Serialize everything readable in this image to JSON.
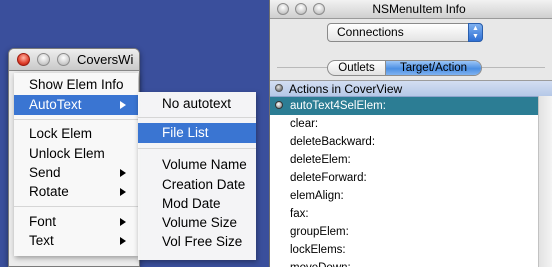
{
  "covers_window": {
    "title": "CoversWi"
  },
  "context_menu": {
    "items": [
      {
        "label": "Show Elem Info"
      },
      {
        "label": "AutoText"
      },
      {
        "label": "Lock Elem"
      },
      {
        "label": "Unlock Elem"
      },
      {
        "label": "Send"
      },
      {
        "label": "Rotate"
      },
      {
        "label": "Font"
      },
      {
        "label": "Text"
      }
    ]
  },
  "autotext_submenu": {
    "items": [
      {
        "label": "No autotext"
      },
      {
        "label": "File List"
      },
      {
        "label": "Volume Name"
      },
      {
        "label": "Creation Date"
      },
      {
        "label": "Mod Date"
      },
      {
        "label": "Volume Size"
      },
      {
        "label": "Vol Free Size"
      }
    ]
  },
  "info_window": {
    "title": "NSMenuItem Info",
    "popup": {
      "selected": "Connections"
    },
    "tabs": {
      "outlets": "Outlets",
      "target_action": "Target/Action"
    },
    "list": {
      "header": "Actions in CoverView",
      "rows": [
        "autoText4SelElem:",
        "clear:",
        "deleteBackward:",
        "deleteElem:",
        "deleteForward:",
        "elemAlign:",
        "fax:",
        "groupElem:",
        "lockElems:",
        "moveDown:"
      ],
      "selected_index": 0
    }
  },
  "colors": {
    "desktop": "#3a4f9c",
    "menu_highlight": "#3a75d2",
    "list_selection": "#2c7d94"
  }
}
